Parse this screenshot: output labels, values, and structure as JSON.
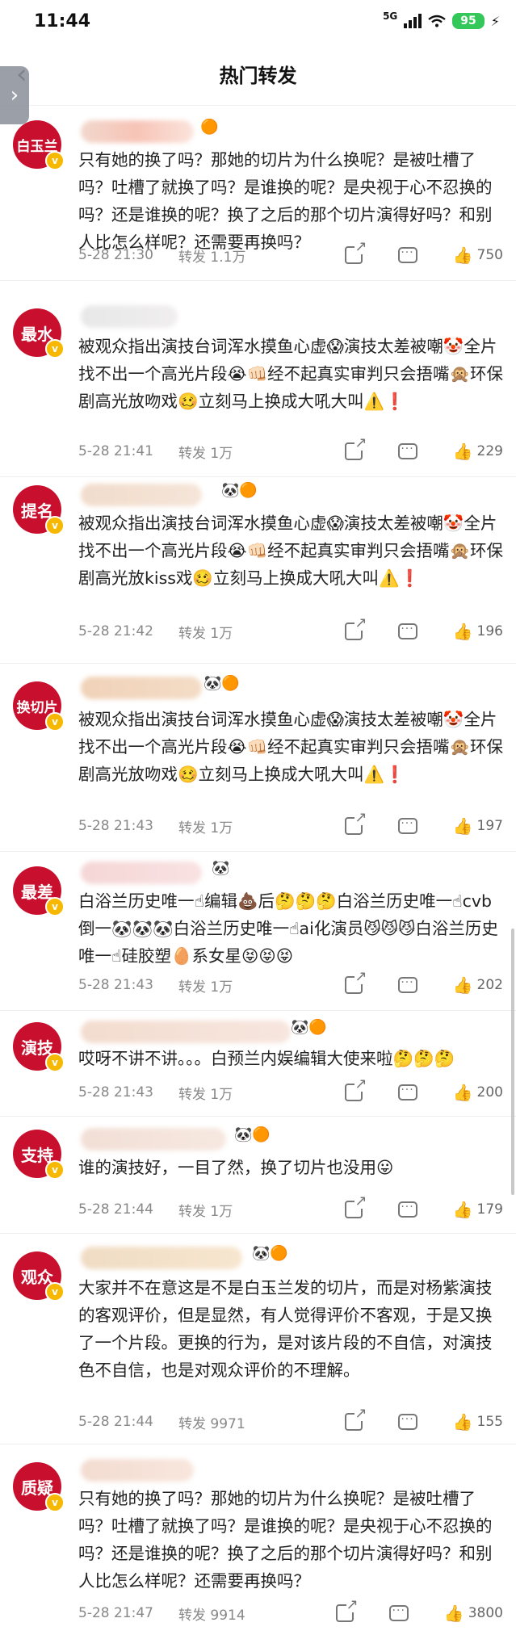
{
  "status": {
    "time": "11:44",
    "signal": "5G",
    "battery": "95"
  },
  "header": {
    "title": "热门转发",
    "back_icon": "chevron-left-icon"
  },
  "items": [
    {
      "avatar": "白玉兰",
      "text": "只有她的换了吗？那她的切片为什么换呢？是被吐槽了吗？吐槽了就换了吗？是谁换的呢？是央视于心不忍换的吗？还是谁换的呢？换了之后的那个切片演得好吗？和别人比怎么样呢？还需要再换吗？",
      "time": "5-28 21:30",
      "repost": "转发 1.1万",
      "likes": "750"
    },
    {
      "avatar": "最水",
      "text": "被观众指出演技台词浑水摸鱼心虚😱演技太差被嘲🤡全片找不出一个高光片段😭👊🏻经不起真实审判只会捂嘴🙊环保剧高光放吻戏🥴立刻马上换成大吼大叫⚠️❗",
      "time": "5-28 21:41",
      "repost": "转发 1万",
      "likes": "229"
    },
    {
      "avatar": "提名",
      "text": "被观众指出演技台词浑水摸鱼心虚😱演技太差被嘲🤡全片找不出一个高光片段😭👊🏻经不起真实审判只会捂嘴🙊环保剧高光放kiss戏🥴立刻马上换成大吼大叫⚠️❗",
      "time": "5-28 21:42",
      "repost": "转发 1万",
      "likes": "196"
    },
    {
      "avatar": "换切片",
      "text": "被观众指出演技台词浑水摸鱼心虚😱演技太差被嘲🤡全片找不出一个高光片段😭👊🏻经不起真实审判只会捂嘴🙊环保剧高光放吻戏🥴立刻马上换成大吼大叫⚠️❗",
      "time": "5-28 21:43",
      "repost": "转发 1万",
      "likes": "197"
    },
    {
      "avatar": "最差",
      "text": "白浴兰历史唯一☝编辑💩后🤔🤔🤔白浴兰历史唯一☝cvb倒一🐼🐼🐼白浴兰历史唯一☝ai化演员😼😼😼白浴兰历史唯一☝硅胶塑🥚系女星😝😝😝",
      "time": "5-28 21:43",
      "repost": "转发 1万",
      "likes": "202"
    },
    {
      "avatar": "演技",
      "text": "哎呀不讲不讲。。。白预兰内娱编辑大使来啦🤔🤔🤔",
      "time": "5-28 21:43",
      "repost": "转发 1万",
      "likes": "200"
    },
    {
      "avatar": "支持",
      "text": "谁的演技好，一目了然，换了切片也没用😛",
      "time": "5-28 21:44",
      "repost": "转发 1万",
      "likes": "179"
    },
    {
      "avatar": "观众",
      "text": "大家并不在意这是不是白玉兰发的切片，而是对杨紫演技的客观评价，但是显然，有人觉得评价不客观，于是又换了一个片段。更换的行为，是对该片段的不自信，对演技色不自信，也是对观众评价的不理解。",
      "time": "5-28 21:44",
      "repost": "转发 9971",
      "likes": "155"
    },
    {
      "avatar": "质疑",
      "text": "只有她的换了吗？那她的切片为什么换呢？是被吐槽了吗？吐槽了就换了吗？是谁换的呢？是央视于心不忍换的吗？还是谁换的呢？换了之后的那个切片演得好吗？和别人比怎么样呢？还需要再换吗？",
      "time": "5-28 21:47",
      "repost": "转发 9914",
      "likes": "3800"
    }
  ]
}
